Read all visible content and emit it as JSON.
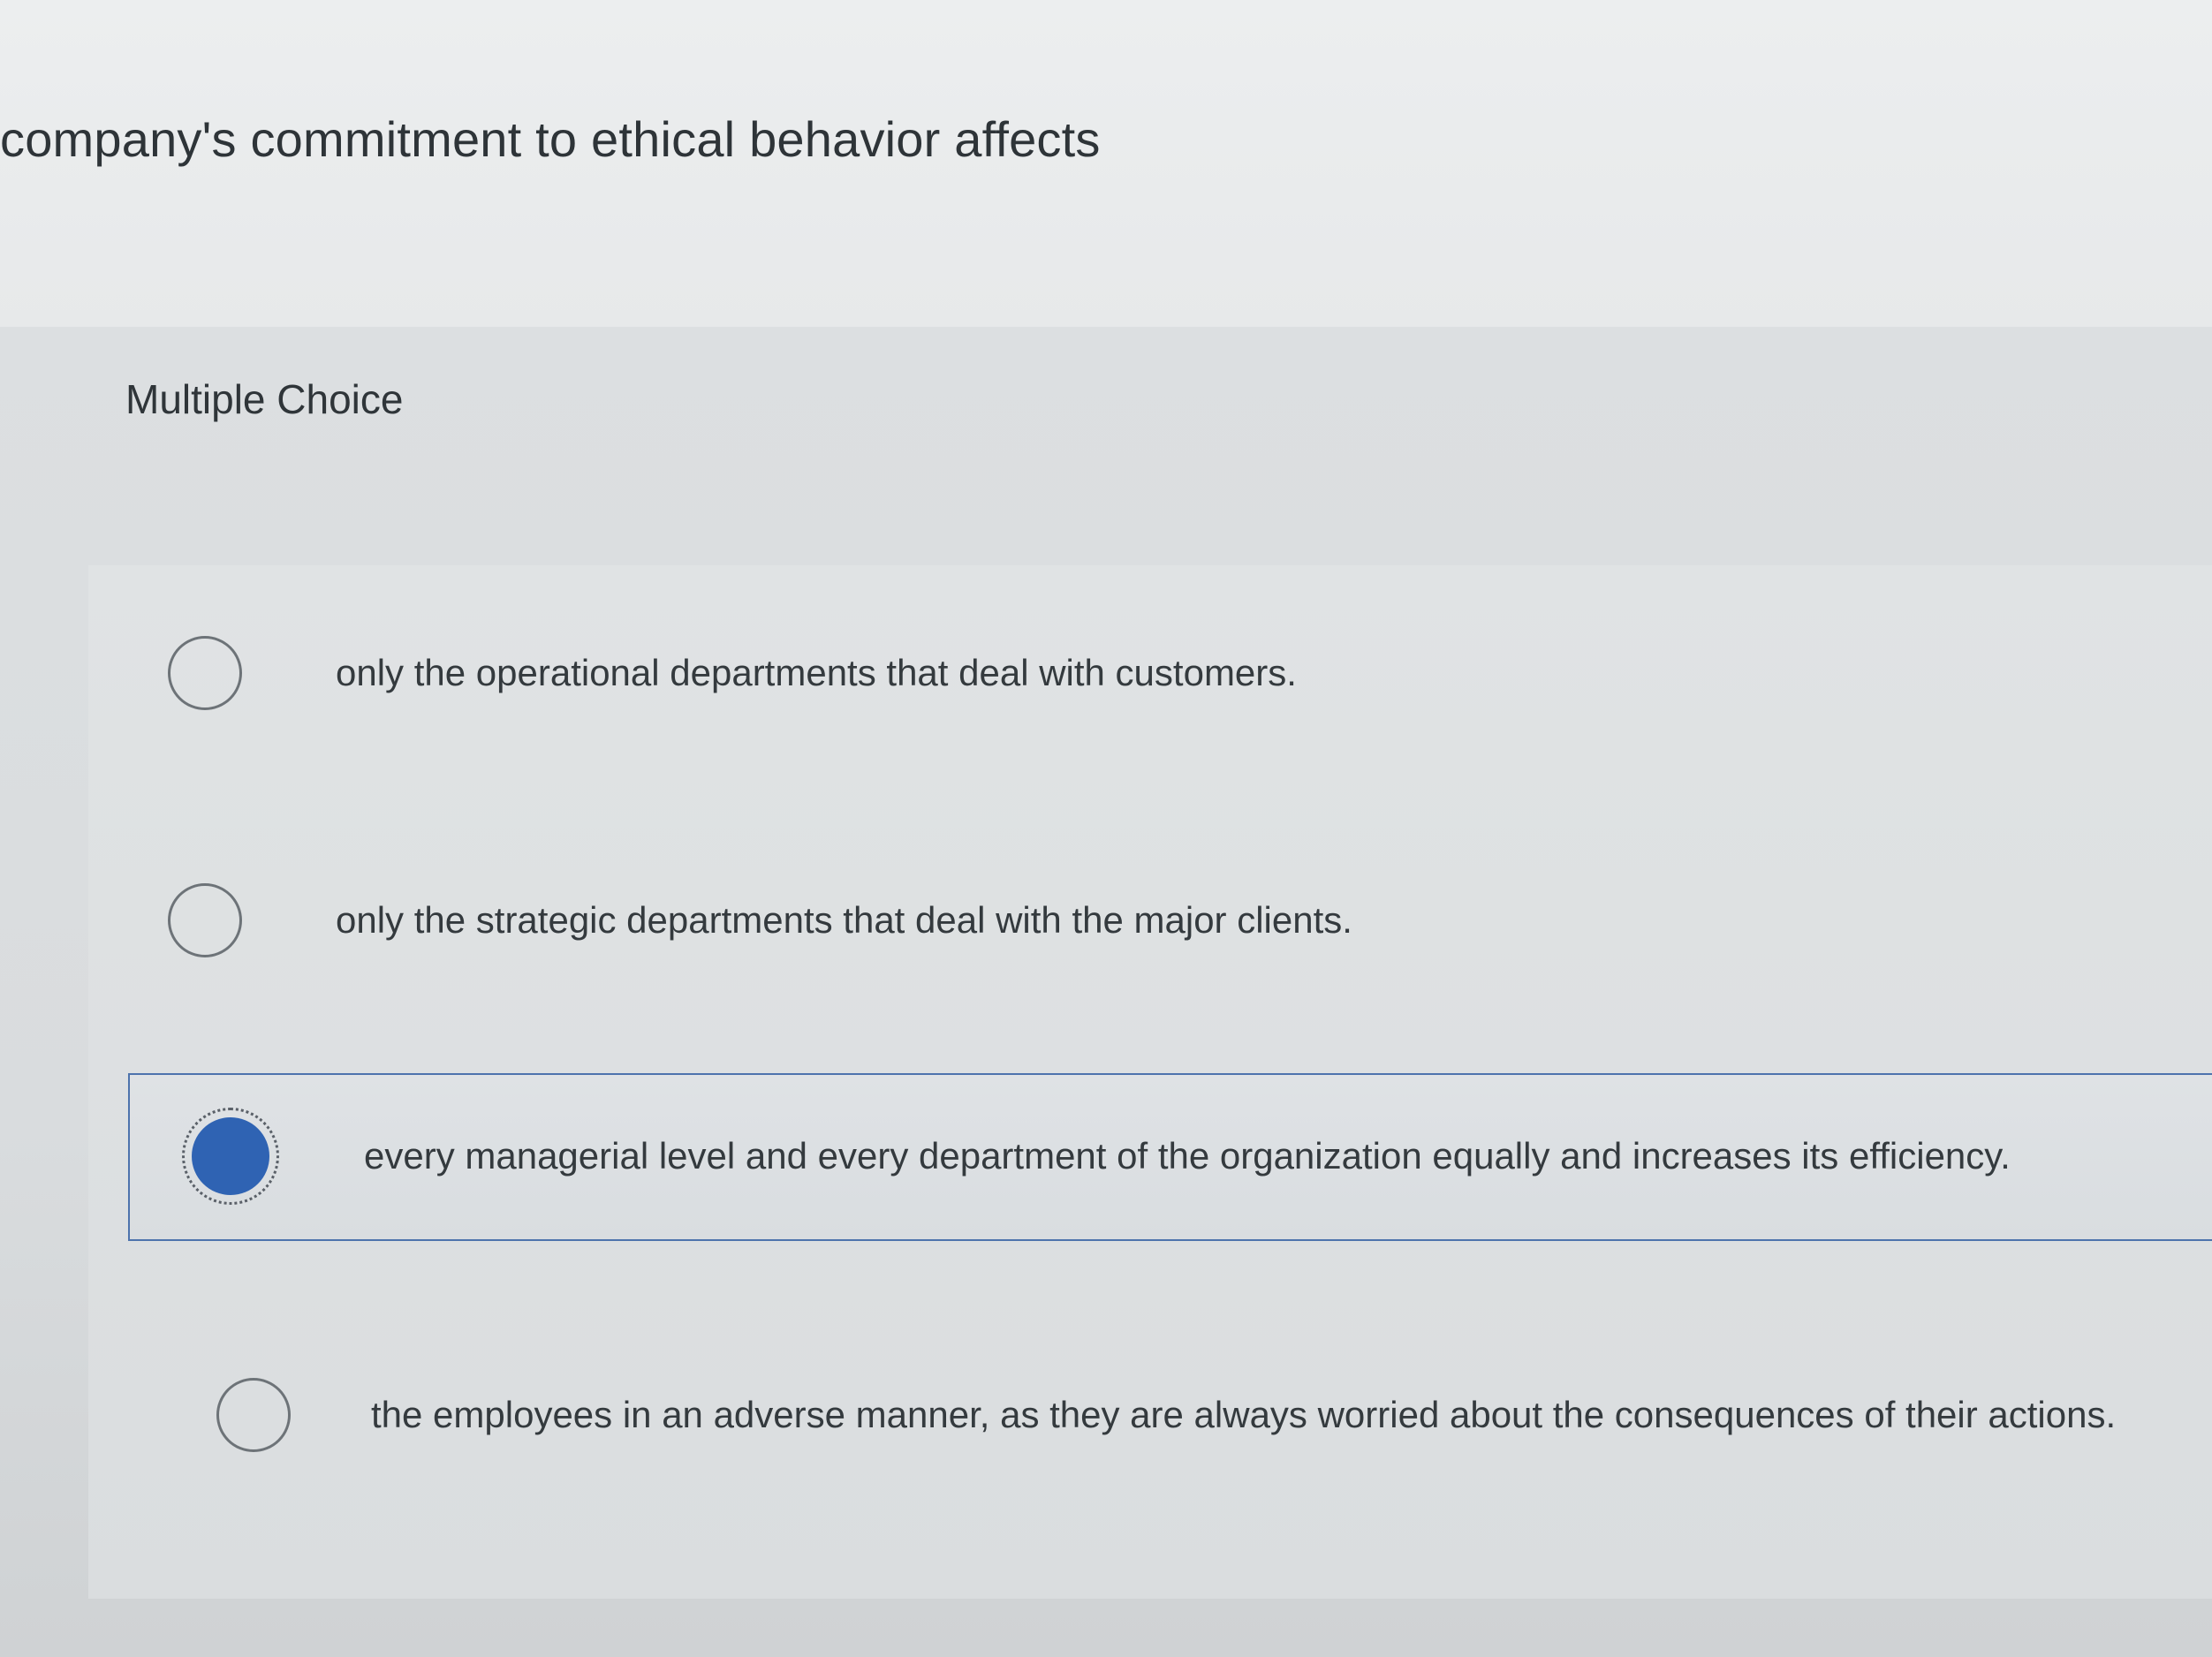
{
  "question": {
    "text": "company's commitment to ethical behavior affects"
  },
  "section": {
    "label": "Multiple Choice"
  },
  "options": [
    {
      "text": "only the operational departments that deal with customers.",
      "selected": false
    },
    {
      "text": "only the strategic departments that deal with the major clients.",
      "selected": false
    },
    {
      "text": "every managerial level and every department of the organization equally and increases its efficiency.",
      "selected": true
    },
    {
      "text": "the employees in an adverse manner, as they are always worried about the consequences of their actions.",
      "selected": false
    }
  ],
  "colors": {
    "selected_radio": "#2f63b3",
    "selected_border": "#4d73ad",
    "text": "#333a3f"
  }
}
